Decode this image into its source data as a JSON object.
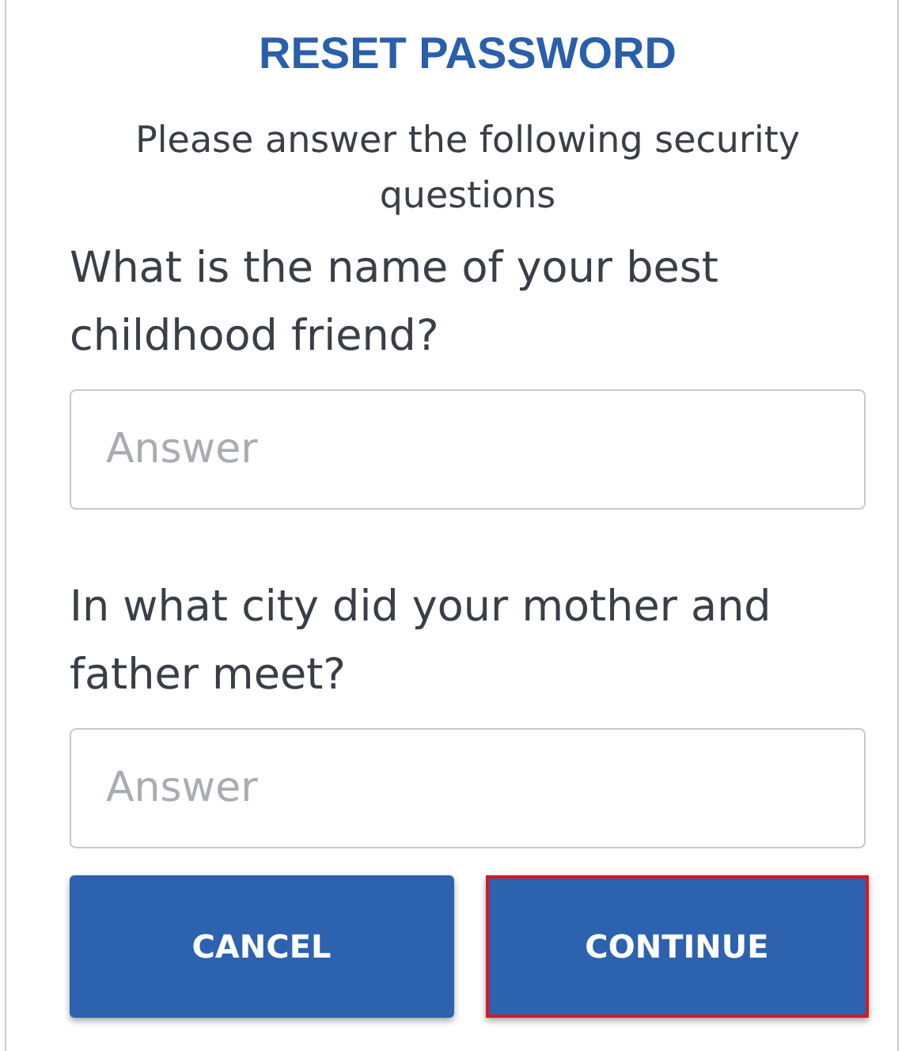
{
  "title": "RESET PASSWORD",
  "subtitle": "Please answer the following security questions",
  "questions": [
    {
      "label": "What is the name of your best childhood friend?",
      "placeholder": "Answer"
    },
    {
      "label": "In what city did your mother and father meet?",
      "placeholder": "Answer"
    }
  ],
  "buttons": [
    {
      "label": "CANCEL",
      "focused": false
    },
    {
      "label": "CONTINUE",
      "focused": true
    }
  ]
}
